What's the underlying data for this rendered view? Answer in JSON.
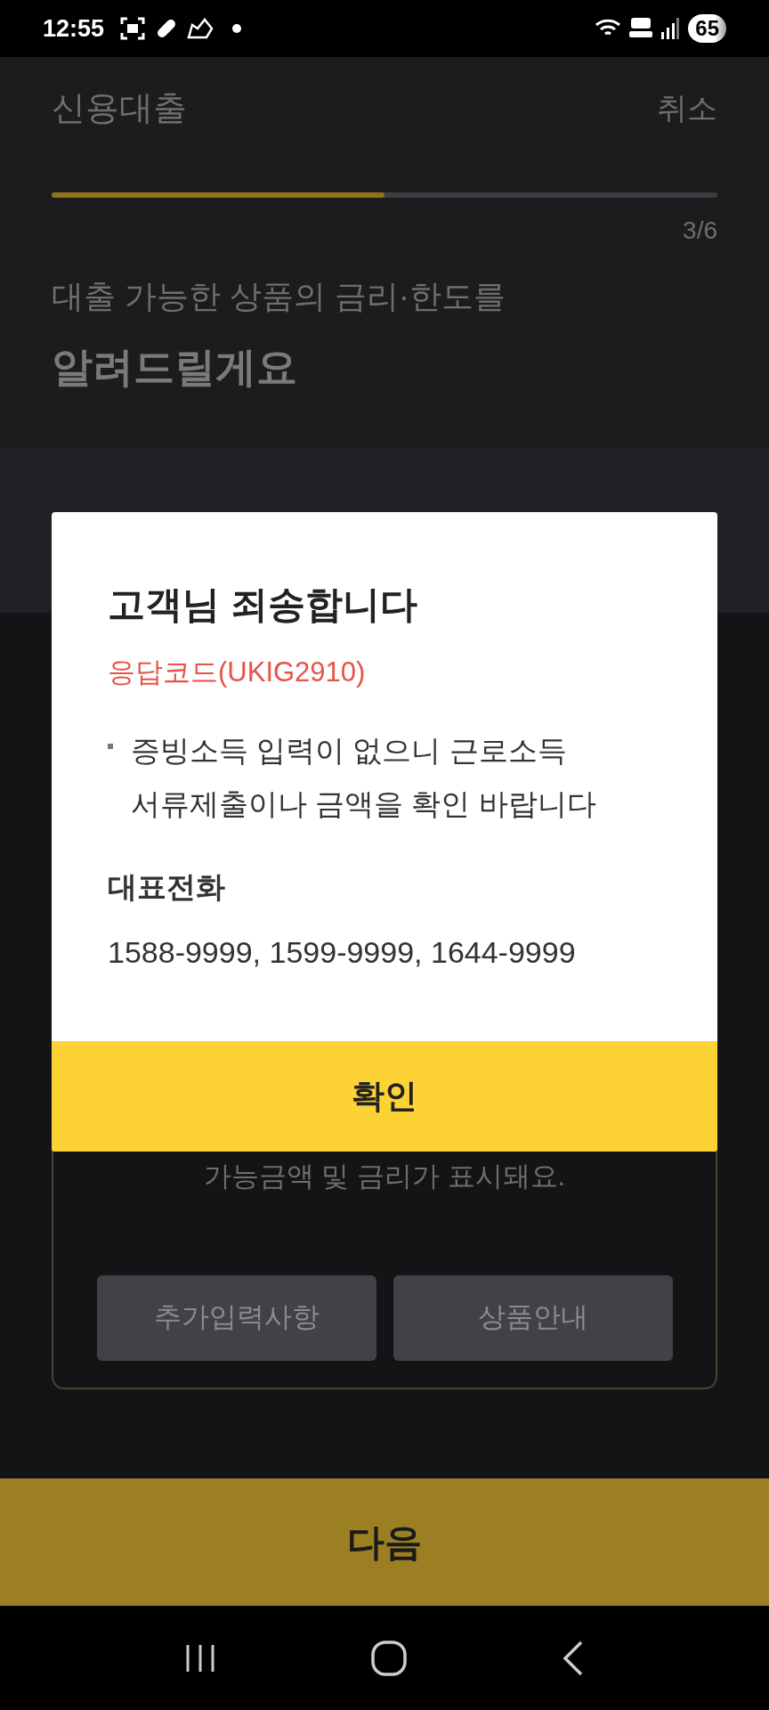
{
  "status_bar": {
    "time": "12:55",
    "battery": "65"
  },
  "header": {
    "title": "신용대출",
    "cancel": "취소"
  },
  "progress": {
    "level": 0.5,
    "step": "3/6"
  },
  "heading": {
    "line1": "대출 가능한 상품의 금리·한도를",
    "line2": "알려드릴게요"
  },
  "card": {
    "text": "가능금액 및 금리가 표시돼요.",
    "buttons": [
      "추가입력사항",
      "상품안내"
    ]
  },
  "next_button": "다음",
  "dialog": {
    "title": "고객님 죄송합니다",
    "code": "응답코드(UKIG2910)",
    "bullets": [
      "증빙소득 입력이 없으니 근로소득\n서류제출이나 금액을 확인 바랍니다"
    ],
    "phone_label": "대표전화",
    "phones": "1588-9999, 1599-9999, 1644-9999",
    "confirm": "확인"
  }
}
